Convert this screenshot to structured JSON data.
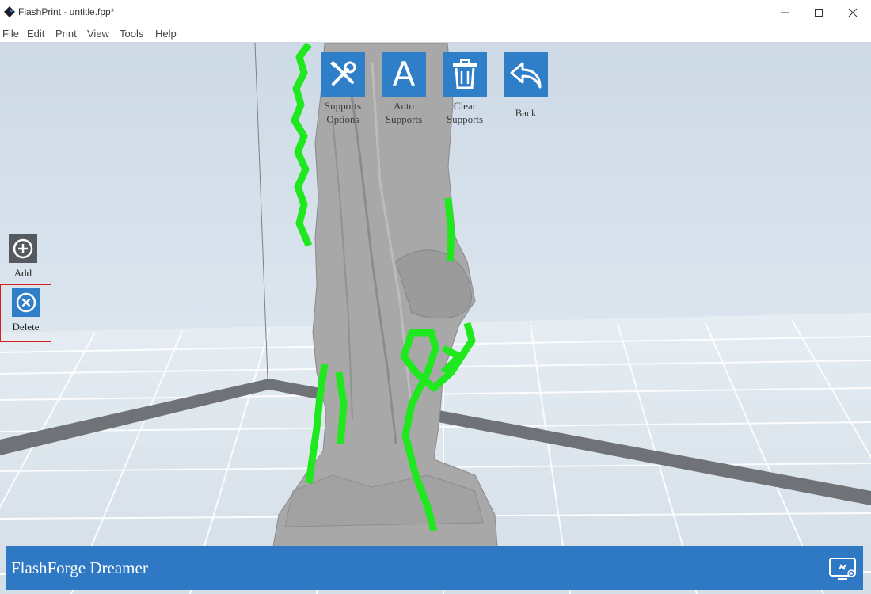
{
  "window": {
    "title": "FlashPrint - untitle.fpp*",
    "controls": [
      "minimize-icon",
      "maximize-icon",
      "close-icon"
    ]
  },
  "menu": [
    "File",
    "Edit",
    "Print",
    "View",
    "Tools",
    "Help"
  ],
  "toolbar": [
    {
      "label": "Supports\nOptions",
      "icon": "tools-icon"
    },
    {
      "label": "Auto\nSupports",
      "icon": "letter-a-icon",
      "glyph": "A"
    },
    {
      "label": "Clear\nSupports",
      "icon": "trash-icon"
    },
    {
      "label": "Back",
      "icon": "back-arrow-icon"
    }
  ],
  "side_tools": {
    "add": {
      "label": "Add",
      "icon": "plus-circle-icon"
    },
    "delete": {
      "label": "Delete",
      "icon": "x-circle-icon",
      "selected": true
    }
  },
  "status": {
    "printer_name": "FlashForge Dreamer",
    "icon": "connect-icon"
  },
  "colors": {
    "accent": "#2f7ec8",
    "support": "#1fe81f",
    "model": "#a6a6a6",
    "selection_border": "#d71c1c"
  }
}
